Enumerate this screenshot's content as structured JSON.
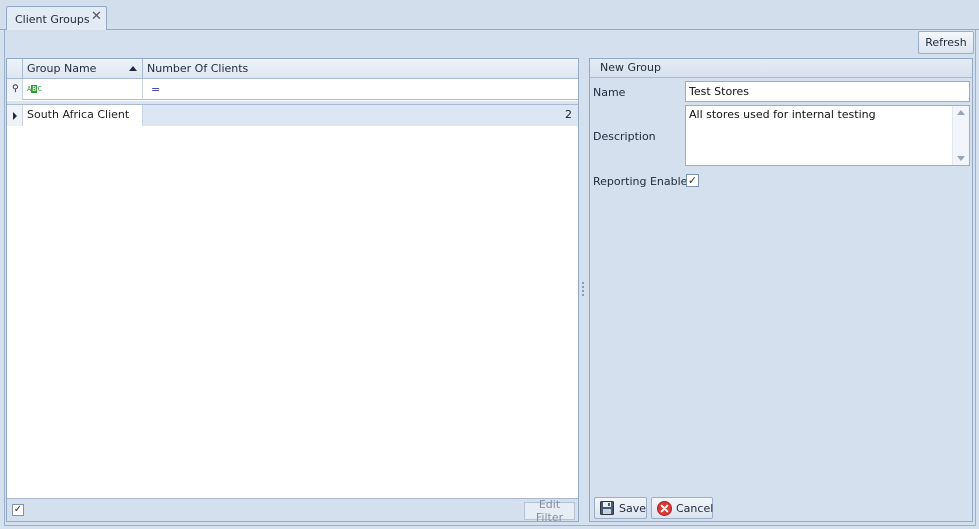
{
  "tab": {
    "label": "Client Groups",
    "close_glyph": "✕"
  },
  "toolbar": {
    "refresh_label": "Refresh"
  },
  "grid": {
    "columns": [
      "Group Name",
      "Number Of Clients"
    ],
    "filter_pin_glyph": "⚲",
    "filter_text_icon": "ABC",
    "filter_equals_glyph": "=",
    "rows": [
      {
        "group_name": "South Africa Client",
        "number_of_clients": "2"
      }
    ],
    "footer": {
      "filter_check_glyph": "✓",
      "edit_filter_label": "Edit Filter"
    }
  },
  "panel": {
    "title": "New Group",
    "name_label": "Name",
    "name_value": "Test Stores",
    "description_label": "Description",
    "description_value": "All stores used for internal testing",
    "reporting_label": "Reporting Enabled",
    "reporting_check_glyph": "✓",
    "save_label": "Save",
    "cancel_label": "Cancel"
  },
  "colors": {
    "accent": "#93a9c6",
    "background": "#d5e0ee",
    "row_highlight": "#dde7f3"
  },
  "icons": {
    "tab_close": "close-icon",
    "save": "floppy-disk-icon",
    "cancel": "cancel-x-circle-icon"
  }
}
